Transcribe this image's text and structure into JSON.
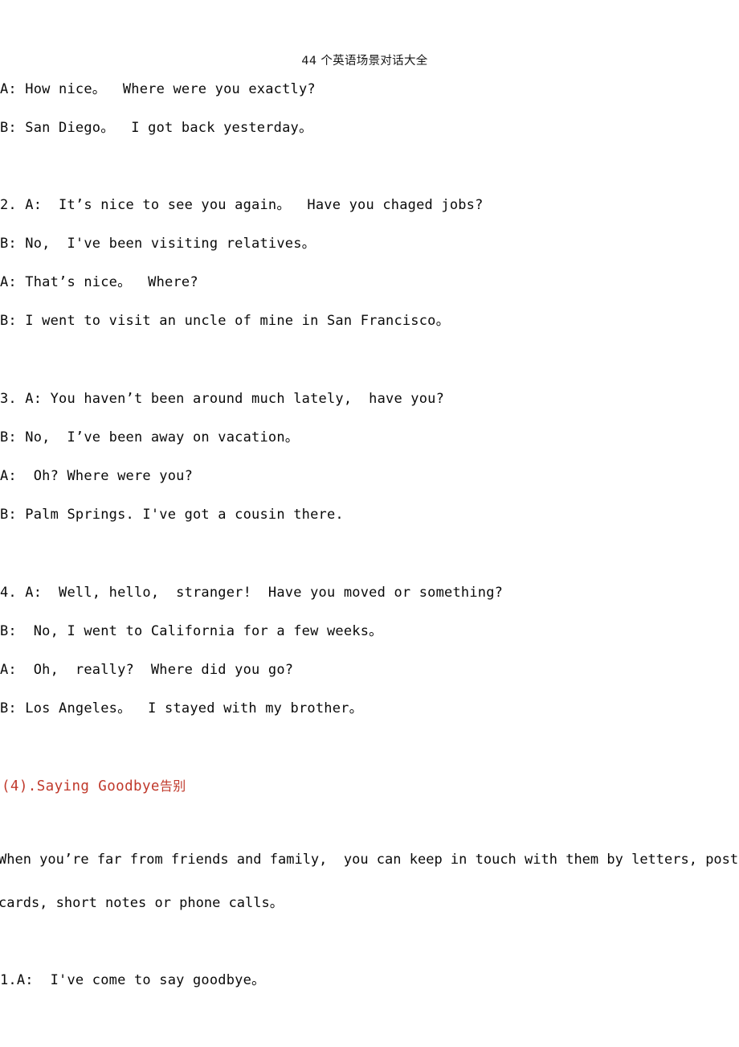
{
  "document": {
    "title": "44 个英语场景对话大全",
    "page_background": "#ffffff",
    "text_color": "#0a0a0a",
    "accent_color": "#c0392b"
  },
  "body": {
    "dialogue_1_continued": [
      {
        "id": "d1-a2",
        "text": "A: How nice。  Where were you exactly?"
      },
      {
        "id": "d1-b2",
        "text": "B: San Diego。  I got back yesterday。"
      }
    ],
    "dialogue_2": [
      {
        "id": "d2-a1",
        "text": "2. A:  It’s nice to see you again。  Have you chaged jobs?"
      },
      {
        "id": "d2-b1",
        "text": "B: No,  I've been visiting relatives。"
      },
      {
        "id": "d2-a2",
        "text": "A: That’s nice。  Where?"
      },
      {
        "id": "d2-b2",
        "text": "B: I went to visit an uncle of mine in San Francisco。"
      }
    ],
    "dialogue_3": [
      {
        "id": "d3-a1",
        "text": "3. A: You haven’t been around much lately,  have you?"
      },
      {
        "id": "d3-b1",
        "text": "B: No,  I’ve been away on vacation。"
      },
      {
        "id": "d3-a2",
        "text": "A:  Oh? Where were you?"
      },
      {
        "id": "d3-b2",
        "text": "B: Palm Springs. I've got a cousin there."
      }
    ],
    "dialogue_4": [
      {
        "id": "d4-a1",
        "text": "4. A:  Well, hello,  stranger!  Have you moved or something?"
      },
      {
        "id": "d4-b1",
        "text": "B:  No, I went to California for a few weeks。"
      },
      {
        "id": "d4-a2",
        "text": "A:  Oh,  really?  Where did you go?"
      },
      {
        "id": "d4-b2",
        "text": "B: Los Angeles。  I stayed with my brother。"
      }
    ],
    "section_heading": {
      "number_and_title": "(4).Saying Goodbye",
      "chinese": "告别"
    },
    "intro_paragraph": [
      {
        "id": "p1-l1",
        "text": "When you’re far from friends and family,  you can keep in touch with them by letters, post"
      },
      {
        "id": "p1-l2",
        "text": "cards, short notes or phone calls。"
      }
    ],
    "dialogue_5": [
      {
        "id": "d5-a1",
        "text": "1.A:  I've come to say goodbye。"
      }
    ]
  }
}
